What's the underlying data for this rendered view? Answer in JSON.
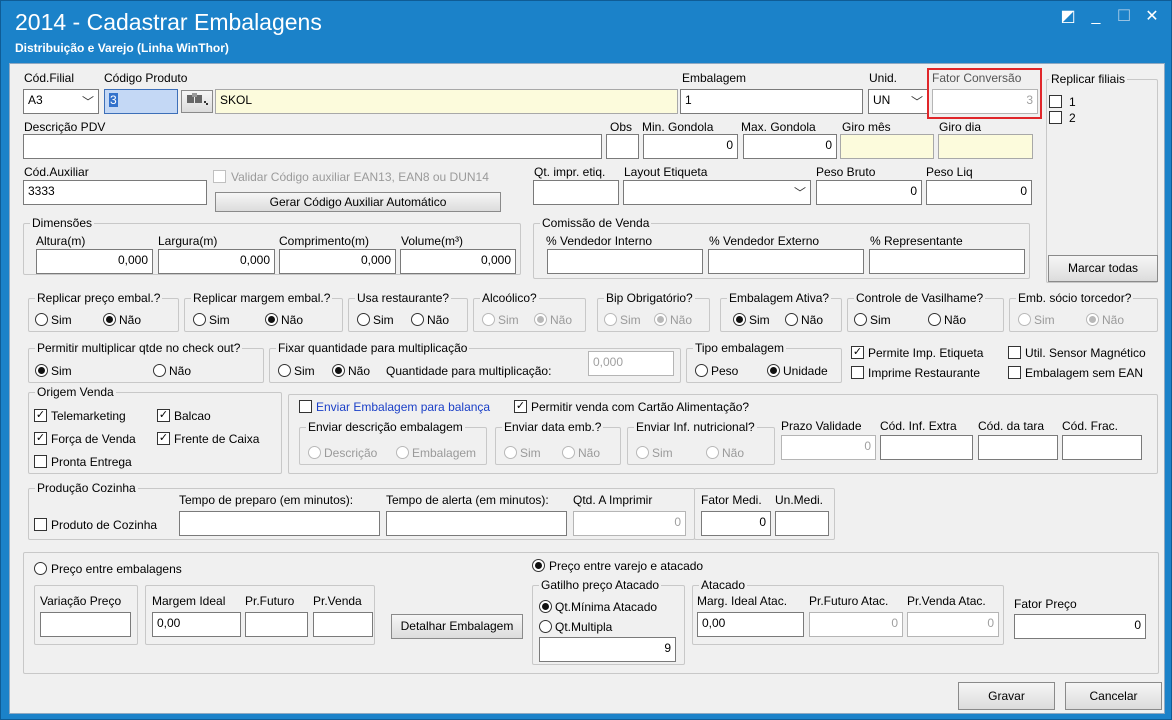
{
  "window": {
    "title": "2014 - Cadastrar Embalagens",
    "subtitle": "Distribuição e Varejo (Linha WinThor)",
    "controls": [
      "◩",
      "_",
      "☐",
      "✕"
    ]
  },
  "row1": {
    "cod_filial_label": "Cód.Filial",
    "cod_filial_value": "A3",
    "codigo_produto_label": "Código Produto",
    "codigo_produto_value": "3",
    "produto_nome": "SKOL",
    "embalagem_label": "Embalagem",
    "embalagem_value": "1",
    "unid_label": "Unid.",
    "unid_value": "UN",
    "fator_conversao_label": "Fator Conversão",
    "fator_conversao_value": "3",
    "replicar_filiais_label": "Replicar filiais",
    "filiais": [
      "1",
      "2"
    ]
  },
  "row2": {
    "descricao_pdv_label": "Descrição PDV",
    "obs_label": "Obs",
    "min_gondola_label": "Min. Gondola",
    "min_gondola_value": "0",
    "max_gondola_label": "Max. Gondola",
    "max_gondola_value": "0",
    "giro_mes_label": "Giro mês",
    "giro_dia_label": "Giro dia"
  },
  "row3": {
    "cod_auxiliar_label": "Cód.Auxiliar",
    "cod_auxiliar_value": "3333",
    "validar_label": "Validar Código auxiliar EAN13, EAN8 ou DUN14",
    "gerar_button": "Gerar Código Auxiliar Automático",
    "qt_impr_label": "Qt. impr. etiq.",
    "layout_etiqueta_label": "Layout Etiqueta",
    "peso_bruto_label": "Peso Bruto",
    "peso_bruto_value": "0",
    "peso_liq_label": "Peso Liq",
    "peso_liq_value": "0"
  },
  "dimensoes": {
    "title": "Dimensões",
    "altura_label": "Altura(m)",
    "altura_value": "0,000",
    "largura_label": "Largura(m)",
    "largura_value": "0,000",
    "comprimento_label": "Comprimento(m)",
    "comprimento_value": "0,000",
    "volume_label": "Volume(m³)",
    "volume_value": "0,000"
  },
  "comissao": {
    "title": "Comissão de Venda",
    "vendedor_interno": "% Vendedor Interno",
    "vendedor_externo": "% Vendedor Externo",
    "representante": "% Representante"
  },
  "marcar_todas": "Marcar todas",
  "sim": "Sim",
  "nao": "Não",
  "opcoes": {
    "replicar_preco": "Replicar preço embal.?",
    "replicar_margem": "Replicar margem embal.?",
    "usa_restaurante": "Usa restaurante?",
    "alcoolico": "Alcoólico?",
    "bip_obrigatorio": "Bip Obrigatório?",
    "embalagem_ativa": "Embalagem Ativa?",
    "controle_vasilhame": "Controle de Vasilhame?",
    "emb_socio_torcedor": "Emb. sócio torcedor?"
  },
  "row5": {
    "permitir_multiplicar": "Permitir multiplicar qtde no check out?",
    "fixar_quantidade": "Fixar quantidade para multiplicação",
    "quantidade_multiplicacao_label": "Quantidade para multiplicação:",
    "quantidade_multiplicacao_value": "0,000",
    "tipo_embalagem": "Tipo embalagem",
    "peso": "Peso",
    "unidade": "Unidade",
    "permite_imp_etiqueta": "Permite Imp. Etiqueta",
    "util_sensor": "Util. Sensor Magnético",
    "imprime_restaurante": "Imprime Restaurante",
    "embalagem_sem_ean": "Embalagem sem EAN"
  },
  "origem_venda": {
    "title": "Origem Venda",
    "telemarketing": "Telemarketing",
    "balcao": "Balcao",
    "forca_venda": "Força de Venda",
    "frente_caixa": "Frente de Caixa",
    "pronta_entrega": "Pronta Entrega"
  },
  "balanca": {
    "enviar_embalagem": "Enviar Embalagem para balança",
    "permitir_cartao": "Permitir venda com Cartão Alimentação?",
    "enviar_descricao": "Enviar descrição embalagem",
    "descricao": "Descrição",
    "embalagem": "Embalagem",
    "enviar_data": "Enviar data emb.?",
    "enviar_inf_nutricional": "Enviar Inf. nutricional?",
    "prazo_validade": "Prazo Validade",
    "prazo_validade_value": "0",
    "cod_inf_extra": "Cód. Inf. Extra",
    "cod_tara": "Cód. da tara",
    "cod_frac": "Cód. Frac."
  },
  "producao": {
    "title": "Produção Cozinha",
    "produto_cozinha": "Produto de Cozinha",
    "tempo_preparo": "Tempo de preparo (em minutos):",
    "tempo_alerta": "Tempo de alerta (em minutos):",
    "qtd_imprimir": "Qtd. A Imprimir",
    "qtd_imprimir_value": "0",
    "fator_medi": "Fator Medi.",
    "fator_medi_value": "0",
    "un_medi": "Un.Medi."
  },
  "preco": {
    "preco_entre_embalagens": "Preço entre embalagens",
    "variacao_preco": "Variação Preço",
    "margem_ideal": "Margem Ideal",
    "margem_ideal_value": "0,00",
    "pr_futuro": "Pr.Futuro",
    "pr_venda": "Pr.Venda",
    "detalhar": "Detalhar Embalagem",
    "preco_varejo_atacado": "Preço entre varejo e atacado",
    "gatilho": "Gatilho preço Atacado",
    "qt_minima": "Qt.Mínima Atacado",
    "qt_multipla": "Qt.Multipla",
    "gatilho_value": "9",
    "atacado": "Atacado",
    "marg_ideal_atac": "Marg. Ideal Atac.",
    "marg_ideal_atac_value": "0,00",
    "pr_futuro_atac": "Pr.Futuro Atac.",
    "pr_futuro_atac_value": "0",
    "pr_venda_atac": "Pr.Venda Atac.",
    "pr_venda_atac_value": "0",
    "fator_preco": "Fator Preço",
    "fator_preco_value": "0"
  },
  "footer": {
    "gravar": "Gravar",
    "cancelar": "Cancelar"
  },
  "colors": {
    "titlebar": "#1b82c9",
    "highlight": "#e0262a",
    "yellow_field": "#fcfbdc"
  }
}
